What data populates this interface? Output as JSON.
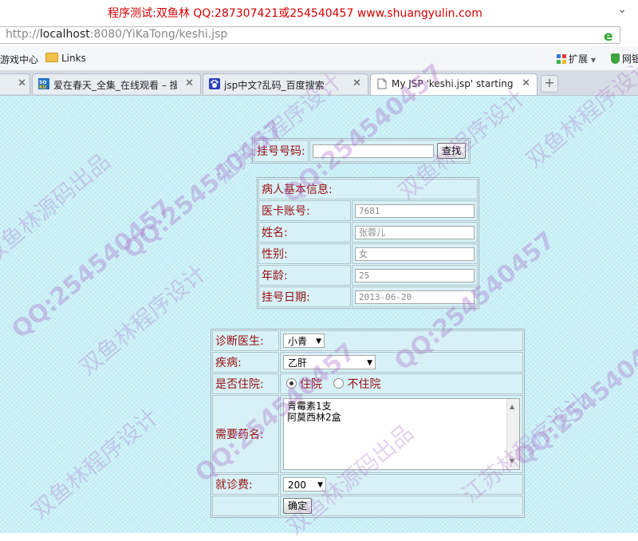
{
  "window": {
    "title": "程序测试:双鱼林 QQ:287307421或254540457 www.shuangyulin.com"
  },
  "address": {
    "prefix": "http://",
    "host": "localhost",
    "rest": ":8080/YiKaTong/keshi.jsp"
  },
  "bookmarks": {
    "items": [
      "游戏中心",
      "Links"
    ],
    "extensions_label": "扩展",
    "shield_label": "网银"
  },
  "tabs": [
    {
      "label": "",
      "active": false
    },
    {
      "label": "爱在春天_全集_在线观看 – 搜索",
      "active": false
    },
    {
      "label": "jsp中文?乱码_百度搜索",
      "active": false
    },
    {
      "label": "My JSP 'keshi.jsp' starting page",
      "active": true
    }
  ],
  "search": {
    "label": "挂号号码:",
    "value": "",
    "button": "查找"
  },
  "patient": {
    "header": "病人基本信息:",
    "fields": [
      {
        "label": "医卡账号:",
        "value": "7681"
      },
      {
        "label": "姓名:",
        "value": "张蓉儿"
      },
      {
        "label": "性别:",
        "value": "女"
      },
      {
        "label": "年龄:",
        "value": "25"
      },
      {
        "label": "挂号日期:",
        "value": "2013-06-20"
      }
    ]
  },
  "diagnosis": {
    "doctor_label": "诊断医生:",
    "doctor_value": "小青",
    "disease_label": "疾病:",
    "disease_value": "乙肝",
    "hospital_label": "是否住院:",
    "option_yes": "住院",
    "option_no": "不住院",
    "selected": "住院",
    "medicine_label": "需要药名:",
    "medicine_lines": [
      "青霉素1支",
      "阿莫西林2盒"
    ],
    "fee_label": "就诊费:",
    "fee_value": "200",
    "submit": "确定"
  },
  "watermark": {
    "qq": "QQ:254540457",
    "text1": "双鱼林源码出品",
    "text2": "双鱼林程序设计",
    "text3": "江苏林程序设计"
  },
  "colors": {
    "title_red": "#d40000",
    "label_red": "#9a1010",
    "page_bg": "#c0ecf4"
  }
}
